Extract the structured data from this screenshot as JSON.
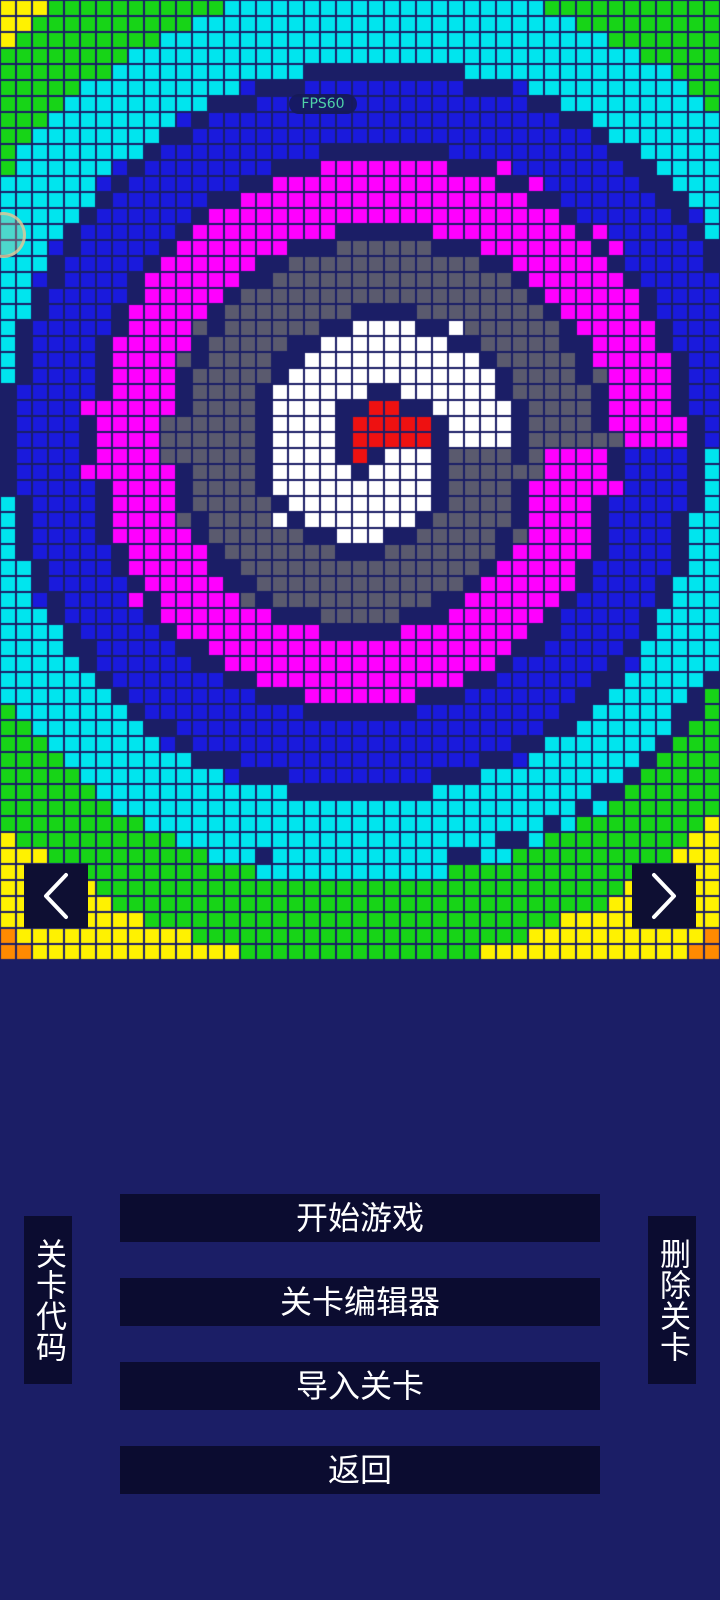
{
  "fps_label": "FPS60",
  "level_preview": {
    "palette": {
      "white": "#ffffff",
      "gray": "#5a5a6e",
      "magenta": "#ff00ff",
      "blue": "#1a1adc",
      "cyan": "#00e5ee",
      "green": "#17d417",
      "yellow": "#fff200",
      "orange": "#ff8a00",
      "red": "#ee1111",
      "background": "#1b1e66"
    }
  },
  "navigation": {
    "prev_icon": "chevron-left-icon",
    "next_icon": "chevron-right-icon"
  },
  "menu": {
    "start": "开始游戏",
    "editor": "关卡编辑器",
    "import": "导入关卡",
    "back": "返回"
  },
  "side_buttons": {
    "level_code": "关卡代码",
    "delete_level": "删除关卡"
  }
}
